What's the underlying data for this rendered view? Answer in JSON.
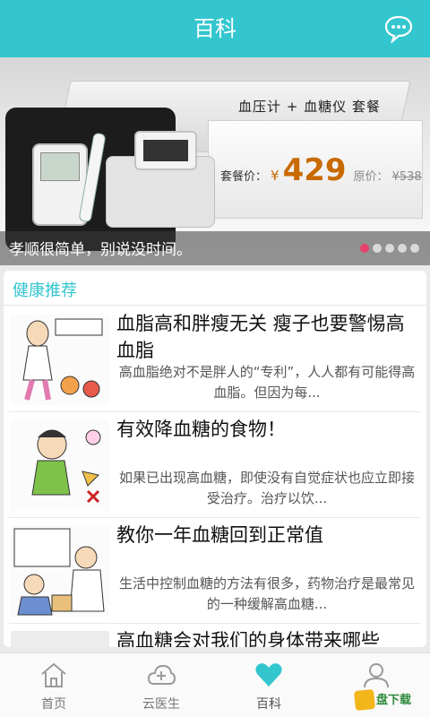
{
  "header": {
    "title": "百科"
  },
  "banner": {
    "tagline": "血压计 + 血糖仪  套餐",
    "price_label": "套餐价：",
    "currency": "¥",
    "price": "429",
    "original_label": "原价：",
    "original_price": "¥538",
    "caption": "孝顺很简单，别说没时间。",
    "slide_count": 5,
    "active_slide": 1
  },
  "section": {
    "title": "健康推荐"
  },
  "articles": [
    {
      "title": "血脂高和胖瘦无关 瘦子也要警惕高血脂",
      "summary": "高血脂绝对不是胖人的“专利”，人人都有可能得高血脂。但因为每..."
    },
    {
      "title": "有效降血糖的食物！",
      "summary": "如果已出现高血糖，即使没有自觉症状也应立即接受治疗。治疗以饮..."
    },
    {
      "title": "教你一年血糖回到正常值",
      "summary": "生活中控制血糖的方法有很多，药物治疗是最常见的一种缓解高血糖..."
    },
    {
      "title": "高血糖会对我们的身体带来哪些",
      "summary": ""
    }
  ],
  "tabs": [
    {
      "label": "首页",
      "icon": "home-icon",
      "active": false
    },
    {
      "label": "云医生",
      "icon": "cloud-plus-icon",
      "active": false
    },
    {
      "label": "百科",
      "icon": "heart-icon",
      "active": true
    },
    {
      "label": "",
      "icon": "user-icon",
      "active": false
    }
  ],
  "colors": {
    "accent": "#33c6cf",
    "price": "#c86a00",
    "active_dot": "#e6416b"
  },
  "watermark": {
    "text": "盘下载"
  }
}
